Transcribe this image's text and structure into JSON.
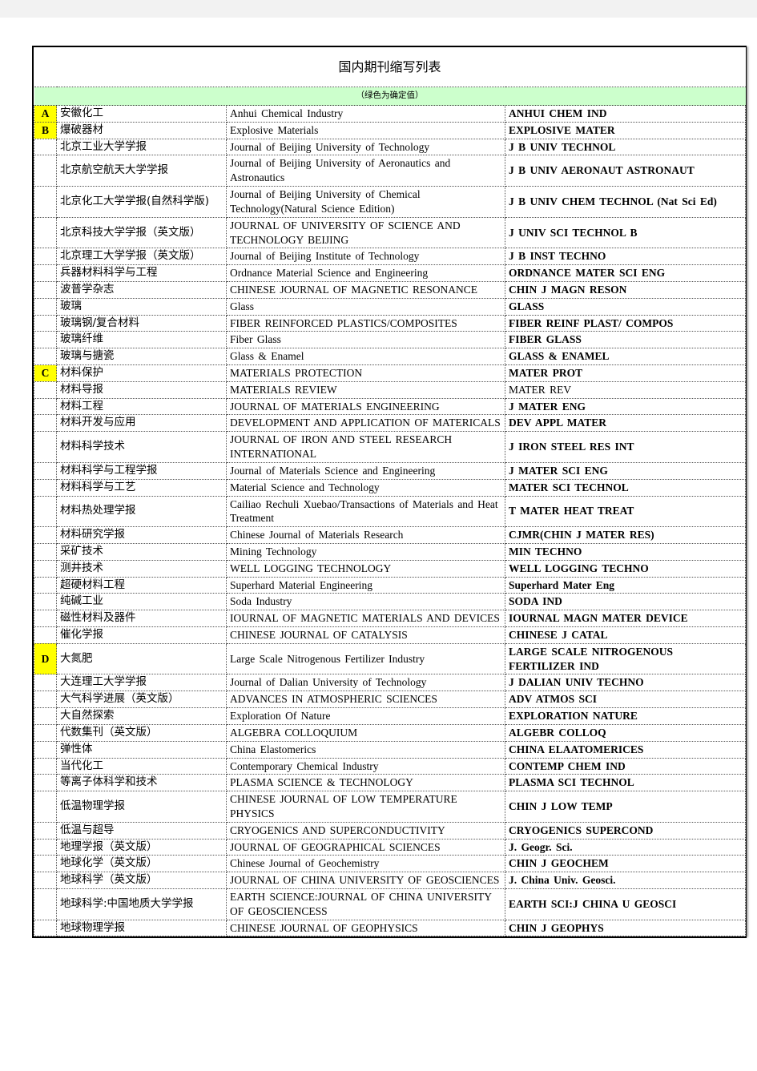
{
  "document": {
    "title": "国内期刊缩写列表",
    "note": "（绿色为确定值）",
    "legend_color_green": "#ccffcc",
    "legend_color_yellow": "#ffff00"
  },
  "rows": [
    {
      "letter": "A",
      "cn": "安徽化工",
      "en": "Anhui Chemical Industry",
      "abbr": "ANHUI CHEM IND",
      "green": false,
      "bold": true
    },
    {
      "letter": "B",
      "cn": "爆破器材",
      "en": "Explosive Materials",
      "abbr": "EXPLOSIVE MATER",
      "green": false,
      "bold": true
    },
    {
      "letter": "",
      "cn": "北京工业大学学报",
      "en": "Journal of Beijing University of Technology",
      "abbr": "J B UNIV TECHNOL",
      "green": false,
      "bold": true
    },
    {
      "letter": "",
      "cn": "北京航空航天大学学报",
      "en": "Journal of Beijing University of Aeronautics and Astronautics",
      "abbr": "J B UNIV AERONAUT ASTRONAUT",
      "green": false,
      "bold": true
    },
    {
      "letter": "",
      "cn": "北京化工大学学报(自然科学版)",
      "en": "Journal of Beijing University of Chemical Technology(Natural Science Edition)",
      "abbr": "J B UNIV CHEM TECHNOL (Nat Sci Ed)",
      "green": false,
      "bold": true
    },
    {
      "letter": "",
      "cn": "北京科技大学学报（英文版）",
      "en": "JOURNAL OF UNIVERSITY OF SCIENCE AND TECHNOLOGY BEIJING",
      "abbr": "J UNIV SCI TECHNOL B",
      "green": true,
      "bold": true
    },
    {
      "letter": "",
      "cn": "北京理工大学学报（英文版）",
      "en": "Journal of Beijing Institute of Technology",
      "abbr": "J B INST TECHNO",
      "green": false,
      "bold": true
    },
    {
      "letter": "",
      "cn": "兵器材料科学与工程",
      "en": "Ordnance Material Science and Engineering",
      "abbr": "ORDNANCE MATER SCI ENG",
      "green": false,
      "bold": true
    },
    {
      "letter": "",
      "cn": "波普学杂志",
      "en": "CHINESE JOURNAL OF MAGNETIC RESONANCE",
      "abbr": "CHIN J MAGN RESON",
      "green": false,
      "bold": true
    },
    {
      "letter": "",
      "cn": "玻璃",
      "en": "Glass",
      "abbr": "GLASS",
      "green": false,
      "bold": true
    },
    {
      "letter": "",
      "cn": "玻璃钢/复合材料",
      "en": "FIBER REINFORCED PLASTICS/COMPOSITES",
      "abbr": "FIBER REINF PLAST/ COMPOS",
      "green": false,
      "bold": true
    },
    {
      "letter": "",
      "cn": "玻璃纤维",
      "en": "Fiber Glass",
      "abbr": "FIBER GLASS",
      "green": false,
      "bold": true
    },
    {
      "letter": "",
      "cn": "玻璃与搪瓷",
      "en": "Glass & Enamel",
      "abbr": "GLASS & ENAMEL",
      "green": false,
      "bold": true
    },
    {
      "letter": "C",
      "cn": "材料保护",
      "en": "MATERIALS PROTECTION",
      "abbr": "MATER PROT",
      "green": false,
      "bold": true
    },
    {
      "letter": "",
      "cn": "材料导报",
      "en": "MATERIALS REVIEW",
      "abbr": "MATER REV",
      "green": false,
      "bold": false
    },
    {
      "letter": "",
      "cn": "材料工程",
      "en": "JOURNAL OF MATERIALS ENGINEERING",
      "abbr": "J MATER ENG",
      "green": true,
      "bold": true
    },
    {
      "letter": "",
      "cn": "材料开发与应用",
      "en": "DEVELOPMENT AND APPLICATION OF MATERICALS",
      "abbr": "DEV APPL MATER",
      "green": true,
      "bold": true
    },
    {
      "letter": "",
      "cn": "材料科学技术",
      "en": "JOURNAL OF IRON AND STEEL RESEARCH INTERNATIONAL",
      "abbr": "J IRON STEEL RES INT",
      "green": true,
      "bold": true
    },
    {
      "letter": "",
      "cn": "材料科学与工程学报",
      "en": "Journal of Materials Science and Engineering",
      "abbr": "J MATER SCI ENG",
      "green": true,
      "bold": true
    },
    {
      "letter": "",
      "cn": "材料科学与工艺",
      "en": "Material Science and Technology",
      "abbr": "MATER SCI TECHNOL",
      "green": false,
      "bold": true
    },
    {
      "letter": "",
      "cn": "材料热处理学报",
      "en": "Cailiao Rechuli Xuebao/Transactions of Materials and Heat Treatment",
      "abbr": "T MATER HEAT TREAT",
      "green": false,
      "bold": true
    },
    {
      "letter": "",
      "cn": "材料研究学报",
      "en": "Chinese Journal of Materials Research",
      "abbr": "CJMR(CHIN J MATER RES)",
      "green": true,
      "bold": true
    },
    {
      "letter": "",
      "cn": "采矿技术",
      "en": "Mining Technology",
      "abbr": "MIN TECHNO",
      "green": false,
      "bold": true
    },
    {
      "letter": "",
      "cn": "测井技术",
      "en": "WELL LOGGING TECHNOLOGY",
      "abbr": "WELL LOGGING TECHNO",
      "green": false,
      "bold": true
    },
    {
      "letter": "",
      "cn": "超硬材料工程",
      "en": "Superhard Material Engineering",
      "abbr": "Superhard Mater Eng",
      "green": false,
      "bold": true
    },
    {
      "letter": "",
      "cn": "纯碱工业",
      "en": "Soda Industry",
      "abbr": "SODA IND",
      "green": false,
      "bold": true
    },
    {
      "letter": "",
      "cn": "磁性材料及器件",
      "en": "IOURNAL OF MAGNETIC MATERIALS AND DEVICES",
      "abbr": "IOURNAL MAGN MATER DEVICE",
      "green": false,
      "bold": true
    },
    {
      "letter": "",
      "cn": "催化学报",
      "en": "CHINESE JOURNAL OF CATALYSIS",
      "abbr": "CHINESE J CATAL",
      "green": true,
      "bold": true
    },
    {
      "letter": "D",
      "cn": "大氮肥",
      "en": "Large Scale Nitrogenous Fertilizer Industry",
      "abbr": "LARGE SCALE NITROGENOUS FERTILIZER IND",
      "green": false,
      "bold": true
    },
    {
      "letter": "",
      "cn": "大连理工大学学报",
      "en": "Journal of Dalian University of Technology",
      "abbr": "J DALIAN UNIV TECHNO",
      "green": false,
      "bold": true
    },
    {
      "letter": "",
      "cn": "大气科学进展（英文版）",
      "en": "ADVANCES IN ATMOSPHERIC SCIENCES",
      "abbr": "ADV ATMOS SCI",
      "green": true,
      "bold": true
    },
    {
      "letter": "",
      "cn": "大自然探索",
      "en": "Exploration Of Nature",
      "abbr": "EXPLORATION NATURE",
      "green": false,
      "bold": true
    },
    {
      "letter": "",
      "cn": "代数集刊（英文版）",
      "en": "ALGEBRA COLLOQUIUM",
      "abbr": "ALGEBR COLLOQ",
      "green": true,
      "bold": true
    },
    {
      "letter": "",
      "cn": "弹性体",
      "en": "China Elastomerics",
      "abbr": "CHINA ELAATOMERICES",
      "green": false,
      "bold": true
    },
    {
      "letter": "",
      "cn": "当代化工",
      "en": "Contemporary Chemical Industry",
      "abbr": "CONTEMP CHEM IND",
      "green": false,
      "bold": true
    },
    {
      "letter": "",
      "cn": "等离子体科学和技术",
      "en": "PLASMA SCIENCE & TECHNOLOGY",
      "abbr": "PLASMA SCI TECHNOL",
      "green": true,
      "bold": true
    },
    {
      "letter": "",
      "cn": "低温物理学报",
      "en": "CHINESE JOURNAL OF LOW TEMPERATURE PHYSICS",
      "abbr": "CHIN J LOW TEMP",
      "green": false,
      "bold": true
    },
    {
      "letter": "",
      "cn": "低温与超导",
      "en": "CRYOGENICS AND SUPERCONDUCTIVITY",
      "abbr": "CRYOGENICS SUPERCOND",
      "green": false,
      "bold": true
    },
    {
      "letter": "",
      "cn": "地理学报（英文版）",
      "en": "JOURNAL OF GEOGRAPHICAL SCIENCES",
      "abbr": "J. Geogr. Sci.",
      "green": true,
      "bold": true
    },
    {
      "letter": "",
      "cn": "地球化学（英文版）",
      "en": "Chinese Journal of Geochemistry",
      "abbr": "CHIN J GEOCHEM",
      "green": false,
      "bold": true
    },
    {
      "letter": "",
      "cn": "地球科学（英文版）",
      "en": "JOURNAL OF CHINA UNIVERSITY OF GEOSCIENCES",
      "abbr": "J. China Univ. Geosci.",
      "green": true,
      "bold": true
    },
    {
      "letter": "",
      "cn": "地球科学:中国地质大学学报",
      "en": "EARTH SCIENCE:JOURNAL OF CHINA UNIVERSITY OF GEOSCIENCESS",
      "abbr": "EARTH SCI:J CHINA U GEOSCI",
      "green": false,
      "bold": true
    },
    {
      "letter": "",
      "cn": "地球物理学报",
      "en": "CHINESE JOURNAL OF GEOPHYSICS",
      "abbr": "CHIN J GEOPHYS",
      "green": true,
      "bold": true
    }
  ]
}
